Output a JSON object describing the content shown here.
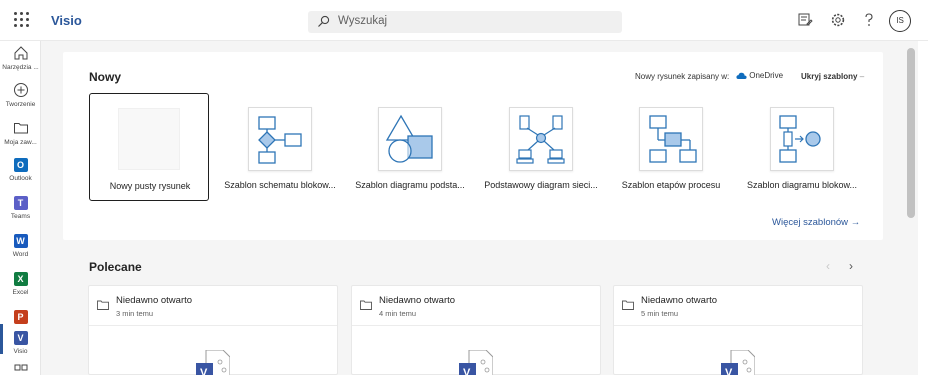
{
  "topbar": {
    "app_name": "Visio",
    "search_placeholder": "Wyszukaj",
    "avatar_initials": "IS"
  },
  "rail": {
    "items": [
      {
        "label": "Narzędzia ...",
        "icon": "home-icon"
      },
      {
        "label": "Tworzenie",
        "icon": "plus-circle-icon"
      },
      {
        "label": "Moja zaw...",
        "icon": "folder-icon"
      },
      {
        "label": "Outlook",
        "icon": "outlook-icon"
      },
      {
        "label": "Teams",
        "icon": "teams-icon"
      },
      {
        "label": "Word",
        "icon": "word-icon"
      },
      {
        "label": "Excel",
        "icon": "excel-icon"
      },
      {
        "label": "",
        "icon": "powerpoint-icon"
      },
      {
        "label": "Visio",
        "icon": "visio-icon"
      }
    ]
  },
  "new_section": {
    "title": "Nowy",
    "save_note": "Nowy rysunek zapisany w:",
    "onedrive": "OneDrive",
    "hide_templates": "Ukryj szablony",
    "templates": [
      {
        "label": "Nowy pusty rysunek"
      },
      {
        "label": "Szablon schematu blokow..."
      },
      {
        "label": "Szablon diagramu podsta..."
      },
      {
        "label": "Podstawowy diagram sieci..."
      },
      {
        "label": "Szablon etapów procesu"
      },
      {
        "label": "Szablon diagramu blokow..."
      }
    ],
    "more_templates": "Więcej szablonów"
  },
  "recommended": {
    "title": "Polecane",
    "cards": [
      {
        "title": "Niedawno otwarto",
        "time": "3 min temu"
      },
      {
        "title": "Niedawno otwarto",
        "time": "4 min temu"
      },
      {
        "title": "Niedawno otwarto",
        "time": "5 min temu"
      }
    ]
  },
  "colors": {
    "accent": "#2b579a",
    "visio_blue": "#3955a3",
    "thumb_fill": "#a9c9ea",
    "thumb_stroke": "#2e75b6"
  }
}
